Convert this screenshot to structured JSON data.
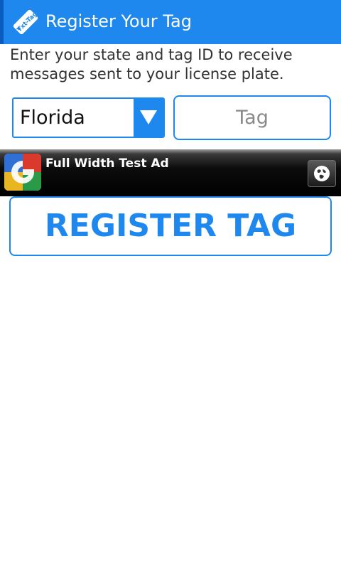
{
  "app_bar": {
    "title": "Register Your Tag",
    "icon": "txt-tag-app-icon",
    "icon_text": "Txt-Tag",
    "color": "#1e88ee"
  },
  "form": {
    "instructions": "Enter your state and tag ID to receive messages sent to your license plate.",
    "state_select": {
      "selected": "Florida"
    },
    "tag_input": {
      "value": "",
      "placeholder": "Tag"
    },
    "submit_label": "REGISTER TAG"
  },
  "ad": {
    "text": "Full Width Test Ad",
    "logo_icon": "google-logo-icon",
    "action_icon": "globe-icon"
  },
  "colors": {
    "accent": "#1e88ee",
    "ad_background": "#000000"
  }
}
